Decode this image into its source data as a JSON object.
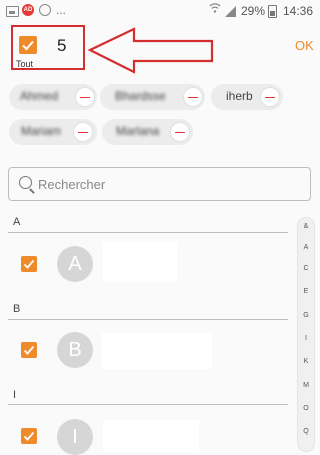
{
  "status_bar": {
    "ad_badge": "AD",
    "more": "...",
    "battery": "29%",
    "time": "14:36",
    "icons": [
      "image-icon",
      "ad-icon",
      "whatsapp-icon",
      "wifi-icon",
      "signal-icon",
      "battery-icon"
    ]
  },
  "header": {
    "select_all_label": "Tout",
    "selected_count": "5",
    "ok_label": "OK"
  },
  "chips": [
    {
      "label": "Ahmed"
    },
    {
      "label": "Bhardsse"
    },
    {
      "label": "iherb"
    },
    {
      "label": "Mariam"
    },
    {
      "label": "Marlana"
    }
  ],
  "search": {
    "placeholder": "Rechercher"
  },
  "sections": [
    {
      "letter": "A",
      "avatar": "A",
      "checked": true
    },
    {
      "letter": "B",
      "avatar": "B",
      "checked": true
    },
    {
      "letter": "I",
      "avatar": "I",
      "checked": true
    }
  ],
  "index": [
    "&",
    "A",
    "C",
    "E",
    "G",
    "I",
    "K",
    "M",
    "O",
    "Q"
  ],
  "colors": {
    "accent": "#ef8a2a",
    "annotation_red": "#d32f2f",
    "remove_red": "#e53935"
  }
}
